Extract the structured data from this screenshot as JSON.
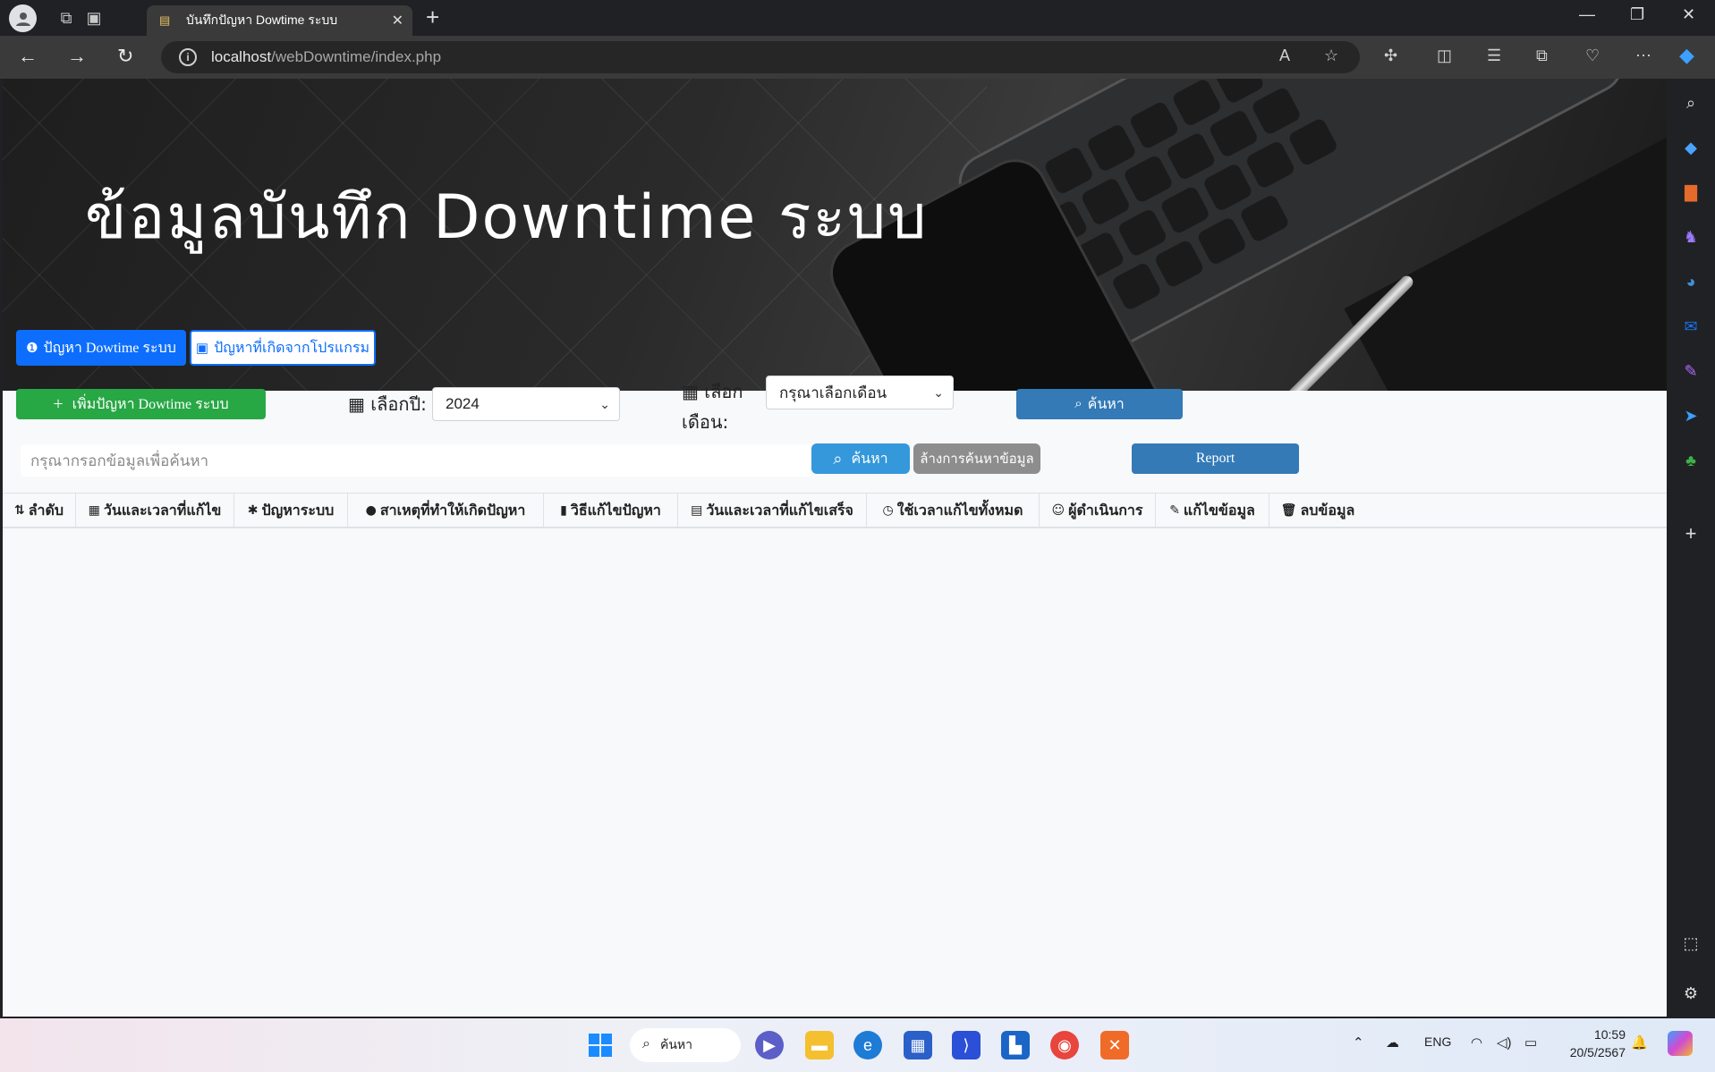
{
  "browser": {
    "tab_title": "บันทึกปัญหา Dowtime ระบบ",
    "url_host": "localhost",
    "url_path": "/webDowntime/index.php"
  },
  "hero": {
    "title": "ข้อมูลบันทึก Downtime ระบบ"
  },
  "tabs": {
    "system": "ปัญหา Dowtime ระบบ",
    "program": "ปัญหาที่เกิดจากโปรแกรม"
  },
  "toolbar": {
    "add_button": "เพิ่มปัญหา Dowtime ระบบ",
    "year_label": "เลือกปี:",
    "year_value": "2024",
    "month_label_1": "เลือก",
    "month_label_2": "เดือน:",
    "month_value": "กรุณาเลือกเดือน",
    "search_button": "ค้นหา"
  },
  "search": {
    "placeholder": "กรุณากรอกข้อมูลเพื่อค้นหา",
    "search_button": "ค้นหา",
    "clear_button": "ล้างการค้นหาข้อมูล",
    "report_button": "Report"
  },
  "table": {
    "headers": [
      {
        "icon": "sort-icon",
        "label": "ลำดับ"
      },
      {
        "icon": "calendar-icon",
        "label": "วันและเวลาที่แก้ไข"
      },
      {
        "icon": "bug-icon",
        "label": "ปัญหาระบบ"
      },
      {
        "icon": "exclamation-circle-icon",
        "label": "สาเหตุที่ทำให้เกิดปัญหา"
      },
      {
        "icon": "book-reader-icon",
        "label": "วิธีแก้ไขปัญหา"
      },
      {
        "icon": "calendar-check-icon",
        "label": "วันและเวลาที่แก้ไขเสร็จ"
      },
      {
        "icon": "clock-icon",
        "label": "ใช้เวลาแก้ไขทั้งหมด"
      },
      {
        "icon": "user-circle-icon",
        "label": "ผู้ดำเนินการ"
      },
      {
        "icon": "edit-icon",
        "label": "แก้ไขข้อมูล"
      },
      {
        "icon": "trash-icon",
        "label": "ลบข้อมูล"
      }
    ]
  },
  "taskbar": {
    "search_label": "ค้นหา",
    "language": "ENG",
    "time": "10:59",
    "date": "20/5/2567"
  }
}
